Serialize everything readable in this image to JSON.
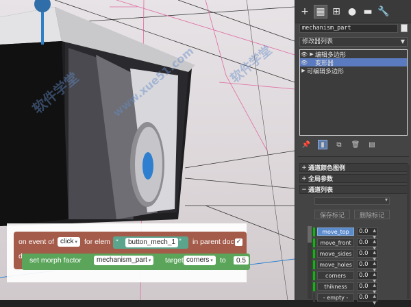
{
  "watermark": {
    "text_cn": "软件学堂",
    "text_url": "www.xue51.com"
  },
  "panel": {
    "tabs": [
      {
        "icon": "create-plus-icon",
        "glyph": "+"
      },
      {
        "icon": "modify-icon",
        "glyph": "▦"
      },
      {
        "icon": "hierarchy-icon",
        "glyph": "⊞"
      },
      {
        "icon": "motion-icon",
        "glyph": "●"
      },
      {
        "icon": "display-icon",
        "glyph": "▬"
      },
      {
        "icon": "utilities-icon",
        "glyph": "🔧"
      }
    ],
    "object_name": "mechanism_part",
    "modifier_list_label": "修改器列表",
    "stack": [
      {
        "label": "编辑多边形",
        "eye": true,
        "expand": "▶",
        "selected": false,
        "indent": 1
      },
      {
        "label": "变形器",
        "eye": true,
        "expand": "",
        "selected": true,
        "indent": 1
      },
      {
        "label": "可编辑多边形",
        "eye": false,
        "expand": "▶",
        "selected": false,
        "indent": 0
      }
    ],
    "rollouts": [
      {
        "sign": "+",
        "label": "通道颜色图例"
      },
      {
        "sign": "+",
        "label": "全局参数"
      },
      {
        "sign": "−",
        "label": "通道列表"
      }
    ],
    "save_marker_label": "保存标记",
    "delete_marker_label": "删除标记",
    "channels": [
      {
        "name": "move_top",
        "value": "0.0",
        "selected": true
      },
      {
        "name": "move_front",
        "value": "0.0",
        "selected": false
      },
      {
        "name": "move_sides",
        "value": "0.0",
        "selected": false
      },
      {
        "name": "move_holes",
        "value": "0.0",
        "selected": false
      },
      {
        "name": "corners",
        "value": "0.0",
        "selected": false
      },
      {
        "name": "thikness",
        "value": "0.0",
        "selected": false
      },
      {
        "name": "- empty -",
        "value": "0.0",
        "selected": false
      }
    ]
  },
  "blocks": {
    "on_event_of": "on event of",
    "event": "click",
    "for_elem": "for elem",
    "elem_name": "button_mech_1",
    "in_parent_doc": "in parent doc",
    "do": "do",
    "set_morph_factor": "set morph factor",
    "object": "mechanism_part",
    "target_label": "target",
    "target": "corners",
    "to_label": "to",
    "value": "0.5",
    "quote_open": "“",
    "quote_close": "”"
  }
}
